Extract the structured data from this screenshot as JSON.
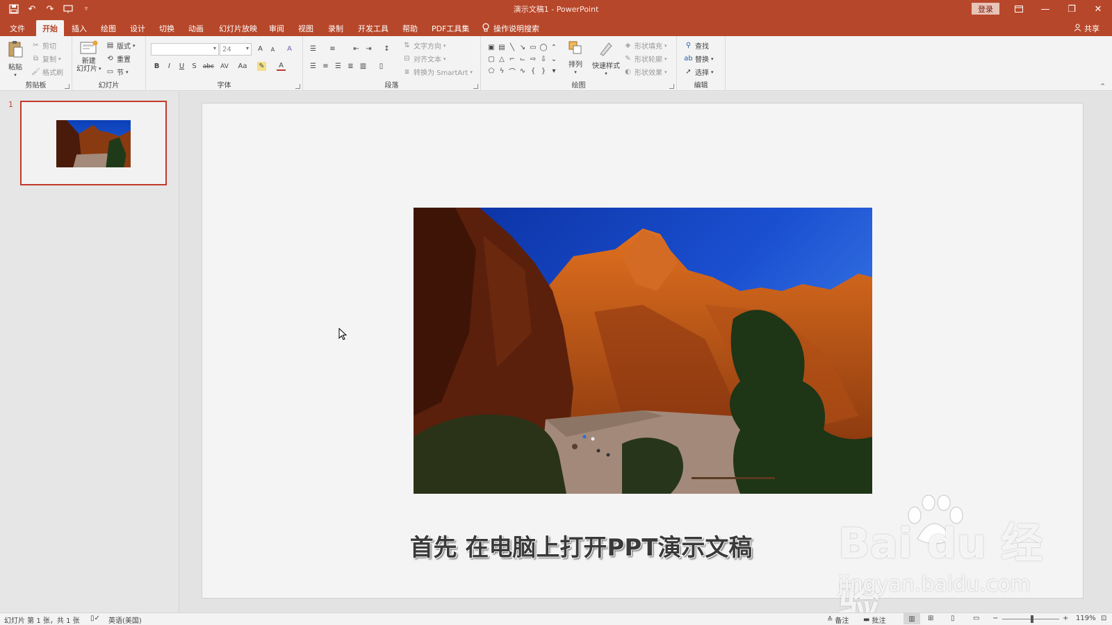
{
  "app": {
    "title": "演示文稿1 - PowerPoint",
    "login": "登录",
    "share": "共享"
  },
  "quick_access": {
    "icons": [
      "save-icon",
      "undo-icon",
      "redo-icon",
      "start-from-beginning-icon",
      "customize-qat-icon"
    ]
  },
  "tabs": [
    "文件",
    "开始",
    "插入",
    "绘图",
    "设计",
    "切换",
    "动画",
    "幻灯片放映",
    "审阅",
    "视图",
    "录制",
    "开发工具",
    "帮助",
    "PDF工具集"
  ],
  "active_tab": "开始",
  "tell_me": "操作说明搜索",
  "ribbon": {
    "clipboard": {
      "label": "剪贴板",
      "paste": "粘贴",
      "cut": "剪切",
      "copy": "复制",
      "format_painter": "格式刷"
    },
    "slides": {
      "label": "幻灯片",
      "new_slide_line1": "新建",
      "new_slide_line2": "幻灯片",
      "layout": "版式",
      "reset": "重置",
      "section": "节"
    },
    "font": {
      "label": "字体",
      "font_name": "",
      "font_size": "24",
      "bold": "B",
      "italic": "I",
      "underline": "U",
      "shadow": "S",
      "strike": "abc",
      "spacing": "AV",
      "case": "Aa",
      "grow": "A",
      "shrink": "A",
      "clear": "A",
      "color": "A"
    },
    "paragraph": {
      "label": "段落",
      "text_direction": "文字方向",
      "align_text": "对齐文本",
      "smartart": "转换为 SmartArt"
    },
    "drawing": {
      "label": "绘图",
      "arrange": "排列",
      "quick_styles": "快速样式",
      "shape_fill": "形状填充",
      "shape_outline": "形状轮廓",
      "shape_effects": "形状效果"
    },
    "editing": {
      "label": "编辑",
      "find": "查找",
      "replace": "替换",
      "select": "选择"
    }
  },
  "slides_panel": {
    "slide_number": "1"
  },
  "slide": {
    "caption": "首先 在电脑上打开PPT演示文稿"
  },
  "watermark": {
    "brand": "Bai du 经验",
    "url": "jingyan.baidu.com"
  },
  "status_bar": {
    "slide_info": "幻灯片 第 1 张，共 1 张",
    "language": "英语(美国)",
    "notes": "备注",
    "comments": "批注",
    "zoom": "119%",
    "zoom_minus": "−",
    "zoom_plus": "+"
  },
  "colors": {
    "accent": "#b7472a",
    "selection": "#c0392b"
  }
}
